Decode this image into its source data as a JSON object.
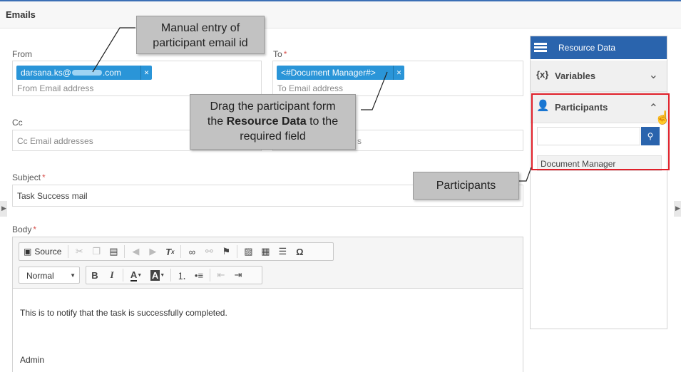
{
  "header": {
    "title": "Emails"
  },
  "form": {
    "from_label": "From",
    "from_chip": "darsana.ks@",
    "from_chip_tail": ".com",
    "from_placeholder": "From Email address",
    "to_label": "To",
    "to_required": "*",
    "to_chip": "<#Document Manager#>",
    "to_placeholder": "To Email address",
    "cc_label": "Cc",
    "cc_placeholder": "Cc Email addresses",
    "bcc_placeholder_tail": "s",
    "subject_label": "Subject",
    "subject_required": "*",
    "subject_value": "Task Success mail",
    "body_label": "Body",
    "body_required": "*"
  },
  "editor": {
    "source_label": "Source",
    "format_value": "Normal",
    "body_line1": "This is to notify that the task is successfully completed.",
    "body_line2": "Admin"
  },
  "panel": {
    "title": "Resource Data",
    "variables_icon": "{x}",
    "variables_label": "Variables",
    "participants_label": "Participants",
    "participant_item": "Document Manager"
  },
  "callouts": {
    "manual_entry": "Manual entry of participant email id",
    "drag_line1": "Drag the participant form",
    "drag_line2_pre": "the ",
    "drag_line2_bold": "Resource Data",
    "drag_line2_post": " to the",
    "drag_line3": "required field",
    "participants": "Participants"
  },
  "colors": {
    "accent": "#2a64ad",
    "chip": "#2a95d8",
    "highlight": "#e0202a"
  }
}
